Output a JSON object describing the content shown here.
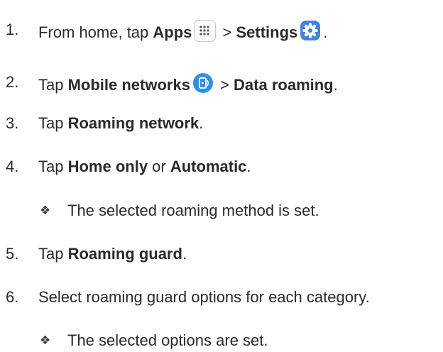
{
  "steps": [
    {
      "number": "1.",
      "parts": [
        "From home, tap ",
        "Apps",
        " > ",
        "Settings",
        "."
      ],
      "icons": [
        "apps-icon",
        "settings-icon"
      ]
    },
    {
      "number": "2.",
      "parts": [
        "Tap ",
        "Mobile networks",
        " > ",
        "Data roaming",
        "."
      ],
      "icons": [
        "mobile-networks-icon"
      ]
    },
    {
      "number": "3.",
      "parts": [
        "Tap ",
        "Roaming network",
        "."
      ]
    },
    {
      "number": "4.",
      "parts": [
        "Tap ",
        "Home only",
        " or ",
        "Automatic",
        "."
      ],
      "result": "The selected roaming method is set."
    },
    {
      "number": "5.",
      "parts": [
        "Tap ",
        "Roaming guard",
        "."
      ]
    },
    {
      "number": "6.",
      "parts": [
        "Select roaming guard options for each category."
      ],
      "result": "The selected options are set."
    }
  ],
  "bullet_glyph": "❖",
  "colors": {
    "text": "#2a2a2a",
    "settings_icon": "#3f84e0",
    "mobile_networks_icon": "#2a8ff0",
    "apps_icon_border": "#c9c9c9"
  }
}
